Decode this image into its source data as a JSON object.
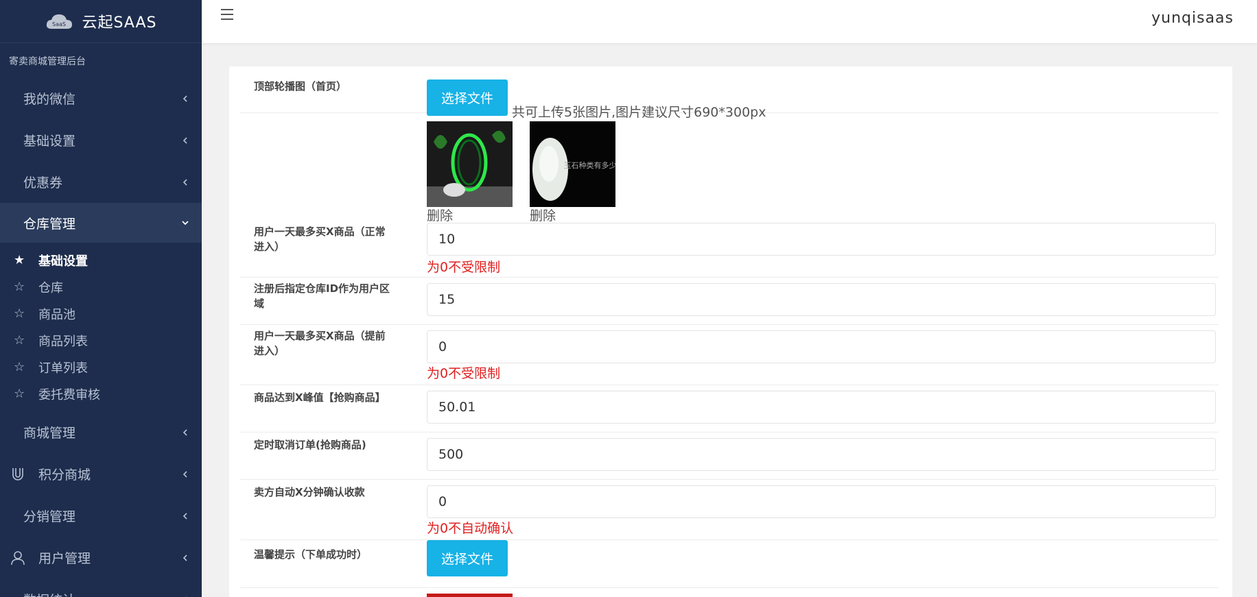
{
  "brand": {
    "logo_text": "SaaS",
    "title": "云起SAAS"
  },
  "sidebar": {
    "subtitle": "寄卖商城管理后台",
    "menu_top": [
      {
        "label": "我的微信"
      },
      {
        "label": "基础设置"
      },
      {
        "label": "优惠券"
      }
    ],
    "active_menu": {
      "label": "仓库管理"
    },
    "submenu": [
      {
        "label": "基础设置",
        "active": true
      },
      {
        "label": "仓库"
      },
      {
        "label": "商品池"
      },
      {
        "label": "商品列表"
      },
      {
        "label": "订单列表"
      },
      {
        "label": "委托费审核"
      }
    ],
    "menu_bottom": [
      {
        "label": "商城管理",
        "icon": "none"
      },
      {
        "label": "积分商城",
        "icon": "magnet-icon"
      },
      {
        "label": "分销管理",
        "icon": "none"
      },
      {
        "label": "用户管理",
        "icon": "user-icon"
      },
      {
        "label": "数据统计",
        "icon": "none"
      }
    ],
    "star_glyph": "☆",
    "star_glyph_active": "★"
  },
  "topbar": {
    "username": "yunqisaas"
  },
  "form": {
    "banner": {
      "label": "顶部轮播图（首页）",
      "button": "选择文件",
      "hint": "共可上传5张图片,图片建议尺寸690*300px",
      "delete_label": "删除",
      "image_2_text": "玉石种类有多少"
    },
    "fields": [
      {
        "label": "用户一天最多买X商品（正常进入）",
        "value": "10",
        "hint": "为0不受限制"
      },
      {
        "label": "注册后指定仓库ID作为用户区域",
        "value": "15",
        "hint": ""
      },
      {
        "label": "用户一天最多买X商品（提前进入）",
        "value": "0",
        "hint": "为0不受限制"
      },
      {
        "label": "商品达到X峰值【抢购商品】",
        "value": "50.01",
        "hint": ""
      },
      {
        "label": "定时取消订单(抢购商品)",
        "value": "500",
        "hint": ""
      },
      {
        "label": "卖方自动X分钟确认收款",
        "value": "0",
        "hint": "为0不自动确认"
      }
    ],
    "tip": {
      "label": "温馨提示（下单成功时）",
      "button": "选择文件"
    }
  }
}
